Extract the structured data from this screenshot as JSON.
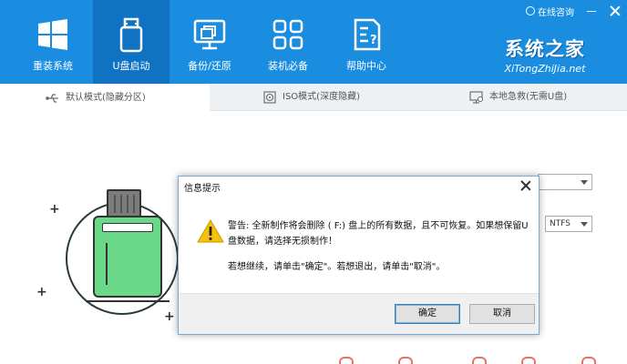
{
  "header": {
    "nav": [
      {
        "label": "重装系统",
        "icon": "windows-logo-icon"
      },
      {
        "label": "U盘启动",
        "icon": "usb-drive-icon"
      },
      {
        "label": "备份/还原",
        "icon": "backup-restore-icon"
      },
      {
        "label": "装机必备",
        "icon": "apps-grid-icon"
      },
      {
        "label": "帮助中心",
        "icon": "help-document-icon"
      }
    ],
    "top_link": "在线咨询",
    "brand_title": "系统之家",
    "brand_subtitle": "XiTongZhiJia.net"
  },
  "tabs": [
    {
      "label": "默认模式(隐藏分区)",
      "icon": "usb-plug-icon"
    },
    {
      "label": "ISO模式(深度隐藏)",
      "icon": "disc-icon"
    },
    {
      "label": "本地急救(无需U盘)",
      "icon": "monitor-icon"
    }
  ],
  "main": {
    "filesystem_value": "NTFS"
  },
  "dialog": {
    "title": "信息提示",
    "message_line1": "警告: 全新制作将会删除 ( F:) 盘上的所有数据，且不可恢复。如果想保留U盘数据，请选择无损制作！",
    "message_line2": "若想继续，请单击\"确定\"。若想退出，请单击\"取消\"。",
    "ok_label": "确定",
    "cancel_label": "取消"
  },
  "colors": {
    "header_blue": "#1a8de0",
    "active_nav": "#0f72c2",
    "usb_green": "#6ad888"
  }
}
